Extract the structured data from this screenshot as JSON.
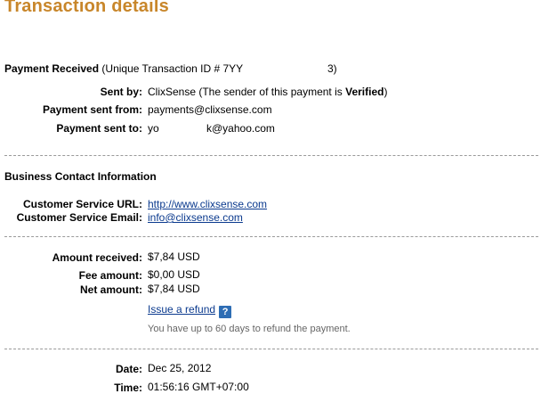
{
  "title": "Transaction details",
  "payment": {
    "heading": "Payment Received",
    "txid": "(Unique Transaction ID # 7YY",
    "txid_end": "3)",
    "sent_by_label": "Sent by:",
    "sent_by_value": "ClixSense (The sender of this payment is ",
    "sent_by_status": "Verified",
    "sent_by_close": ")",
    "from_label": "Payment sent from:",
    "from_value": "payments@clixsense.com",
    "to_label": "Payment sent to:",
    "to_value_start": "yo",
    "to_value_end": "k@yahoo.com"
  },
  "business": {
    "heading": "Business Contact Information",
    "url_label": "Customer Service URL:",
    "url_value": "http://www.clixsense.com",
    "email_label": "Customer Service Email:",
    "email_value": "info@clixsense.com"
  },
  "amounts": {
    "received_label": "Amount received:",
    "received_value": "$7,84 USD",
    "fee_label": "Fee amount:",
    "fee_value": "$0,00 USD",
    "net_label": "Net amount:",
    "net_value": "$7,84 USD",
    "refund_link": "Issue a refund",
    "help_icon": "?",
    "refund_note": "You have up to 60 days to refund the payment."
  },
  "datetime": {
    "date_label": "Date:",
    "date_value": "Dec 25, 2012",
    "time_label": "Time:",
    "time_value": "01:56:16 GMT+07:00"
  }
}
